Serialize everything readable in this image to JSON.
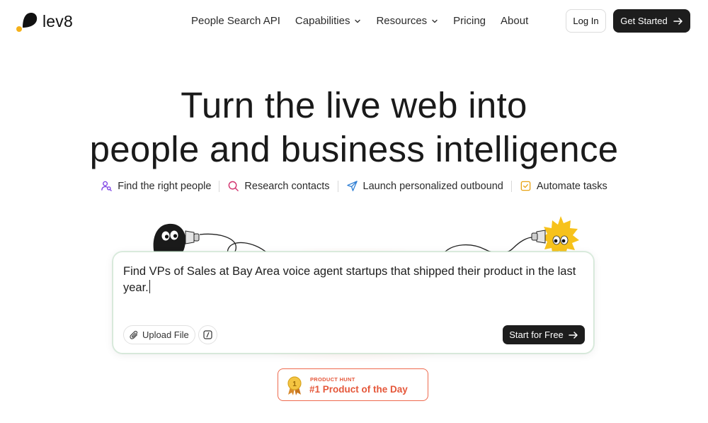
{
  "brand": {
    "name": "lev8",
    "accent": "#f5b11a"
  },
  "nav": {
    "links": [
      {
        "label": "People Search API",
        "dropdown": false
      },
      {
        "label": "Capabilities",
        "dropdown": true
      },
      {
        "label": "Resources",
        "dropdown": true
      },
      {
        "label": "Pricing",
        "dropdown": false
      },
      {
        "label": "About",
        "dropdown": false
      }
    ],
    "login_label": "Log In",
    "get_started_label": "Get Started"
  },
  "hero": {
    "title_line1": "Turn the live web into",
    "title_line2": "people and business intelligence",
    "features": [
      {
        "label": "Find the right people",
        "icon": "person-search-icon",
        "color": "#7b3fe4"
      },
      {
        "label": "Research contacts",
        "icon": "search-icon",
        "color": "#d2336e"
      },
      {
        "label": "Launch personalized outbound",
        "icon": "send-icon",
        "color": "#2f7fd4"
      },
      {
        "label": "Automate tasks",
        "icon": "check-square-icon",
        "color": "#e8a317"
      }
    ]
  },
  "prompt": {
    "text": "Find VPs of Sales at Bay Area voice agent startups that shipped their product in the last year.",
    "upload_label": "Upload File",
    "submit_label": "Start for Free"
  },
  "product_hunt": {
    "small_label": "PRODUCT HUNT",
    "title": "#1 Product of the Day",
    "color": "#e5573a",
    "medal_number": "1"
  }
}
